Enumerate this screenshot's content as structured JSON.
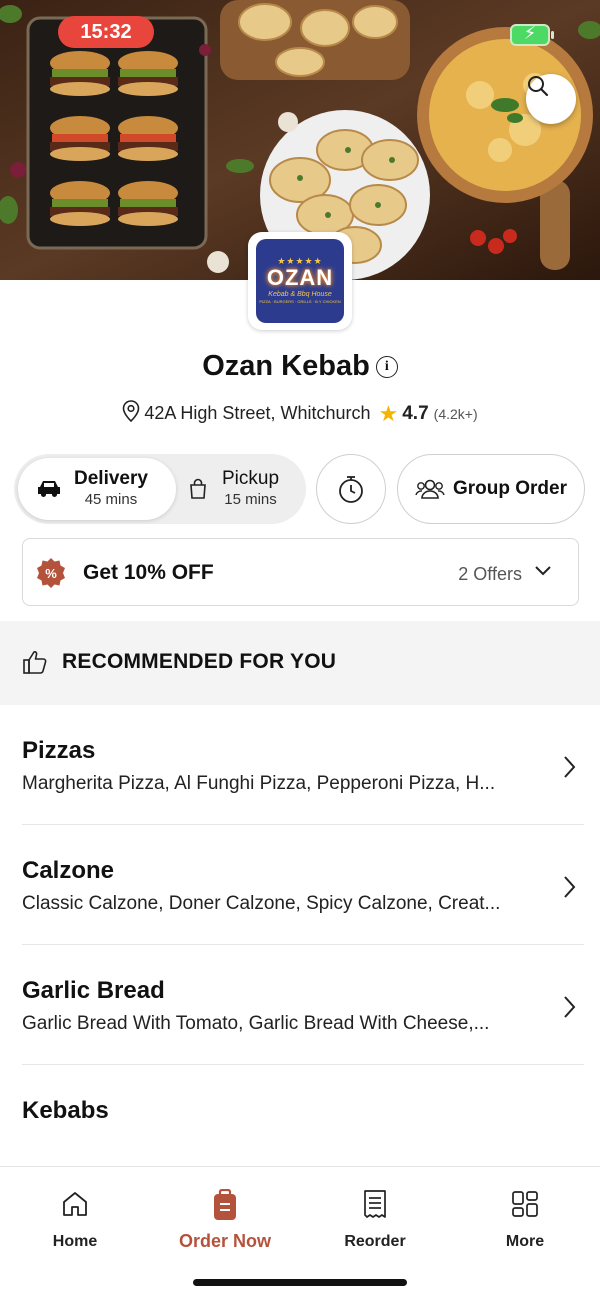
{
  "status_bar": {
    "time": "15:32"
  },
  "restaurant": {
    "name": "Ozan Kebab",
    "address": "42A High Street, Whitchurch",
    "rating": "4.7",
    "rating_count": "(4.2k+)",
    "logo": {
      "brand": "OZAN",
      "tagline": "Kebab & Bbq House",
      "services": "PIZZA · BURGERS · GRILLS · B.Y CHICKEN"
    }
  },
  "order_modes": [
    {
      "label": "Delivery",
      "time": "45 mins",
      "selected": true
    },
    {
      "label": "Pickup",
      "time": "15 mins",
      "selected": false
    }
  ],
  "group_order_label": "Group Order",
  "offer": {
    "title": "Get 10% OFF",
    "count": "2 Offers"
  },
  "recommended": {
    "title": "RECOMMENDED FOR YOU"
  },
  "categories": [
    {
      "name": "Pizzas",
      "items": "Margherita Pizza, Al Funghi Pizza, Pepperoni Pizza, H..."
    },
    {
      "name": "Calzone",
      "items": "Classic Calzone, Doner Calzone, Spicy Calzone, Creat..."
    },
    {
      "name": "Garlic Bread",
      "items": "Garlic Bread With Tomato, Garlic Bread With Cheese,..."
    },
    {
      "name": "Kebabs",
      "items": ""
    }
  ],
  "bottom_nav": [
    {
      "label": "Home",
      "icon": "home-icon"
    },
    {
      "label": "Order Now",
      "icon": "order-icon",
      "active": true
    },
    {
      "label": "Reorder",
      "icon": "receipt-icon"
    },
    {
      "label": "More",
      "icon": "grid-icon"
    }
  ],
  "colors": {
    "accent": "#b4533c",
    "time_pill": "#e8453c",
    "rating_star": "#f5b400",
    "logo_bg": "#2d3b8e"
  }
}
